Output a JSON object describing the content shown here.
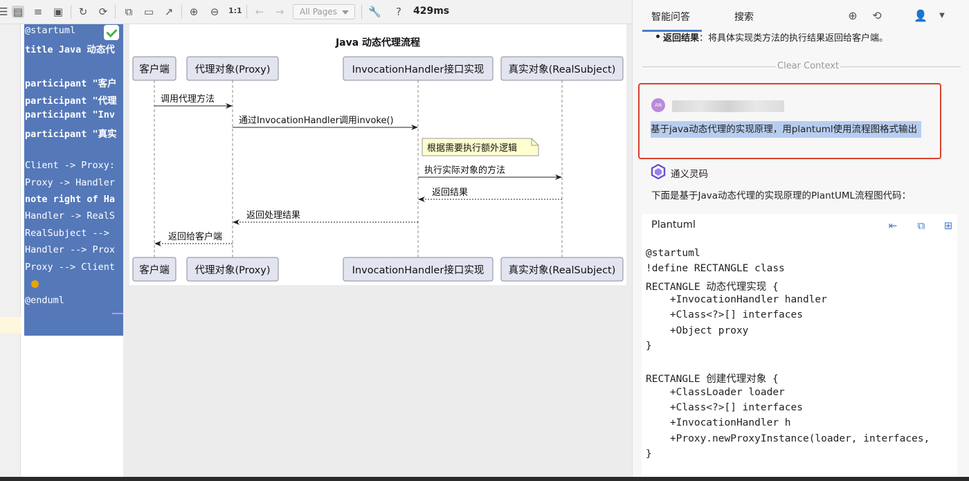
{
  "toolbar": {
    "icons": [
      "list-view-icon",
      "split-view-icon",
      "text-view-icon",
      "image-view-icon",
      "refresh-icon",
      "sync-icon",
      "copy-icon",
      "save-icon",
      "export-icon",
      "zoom-in-icon",
      "zoom-out-icon",
      "back-icon",
      "forward-icon",
      "wrench-icon",
      "help-icon"
    ],
    "actual_size_label": "1:1",
    "pages_select": "All Pages",
    "help_label": "?",
    "timing": "429ms"
  },
  "editor": {
    "lines": [
      "@startuml",
      "title Java 动态代",
      "",
      "participant \"客户",
      "participant \"代理",
      "participant \"Inv",
      "participant \"真实",
      "",
      "Client -> Proxy:",
      "Proxy -> Handler",
      "note right of Ha",
      "Handler -> RealS",
      "RealSubject --> ",
      "Handler --> Prox",
      "Proxy --> Client",
      "",
      "@enduml"
    ]
  },
  "diagram": {
    "title": "Java 动态代理流程",
    "participants": [
      "客户端",
      "代理对象(Proxy)",
      "InvocationHandler接口实现",
      "真实对象(RealSubject)"
    ],
    "messages": [
      {
        "label": "调用代理方法",
        "from": 0,
        "to": 1,
        "dashed": false
      },
      {
        "label": "通过InvocationHandler调用invoke()",
        "from": 1,
        "to": 2,
        "dashed": false
      },
      {
        "label": "执行实际对象的方法",
        "from": 2,
        "to": 3,
        "dashed": false
      },
      {
        "label": "返回结果",
        "from": 3,
        "to": 2,
        "dashed": true
      },
      {
        "label": "返回处理结果",
        "from": 2,
        "to": 1,
        "dashed": true
      },
      {
        "label": "返回给客户端",
        "from": 1,
        "to": 0,
        "dashed": true
      }
    ],
    "note": "根据需要执行额外逻辑"
  },
  "panel": {
    "tabs": [
      "智能问答",
      "搜索"
    ],
    "prev_bullet_bold": "返回结果",
    "prev_bullet_text": "：将具体实现类方法的执行结果返回给客户端。",
    "clear_context": "Clear Context",
    "avatar_initials": "AN",
    "question": "基于java动态代理的实现原理，用plantuml使用流程图格式输出",
    "bot_name": "通义灵码",
    "answer_intro": "下面是基于Java动态代理的实现原理的PlantUML流程图代码：",
    "code_card": {
      "language": "Plantuml",
      "lines": [
        "@startuml",
        "!define RECTANGLE class",
        "RECTANGLE 动态代理实现 {",
        "    +InvocationHandler handler",
        "    +Class<?>[] interfaces",
        "    +Object proxy",
        "}",
        "",
        "RECTANGLE 创建代理对象 {",
        "    +ClassLoader loader",
        "    +Class<?>[] interfaces",
        "    +InvocationHandler h",
        "    +Proxy.newProxyInstance(loader, interfaces,",
        "}"
      ]
    }
  }
}
